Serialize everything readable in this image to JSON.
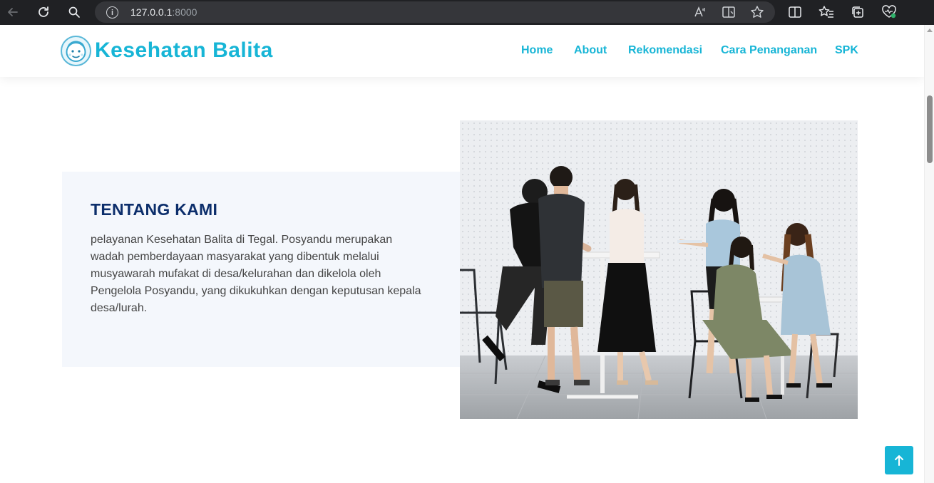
{
  "browser": {
    "url_host": "127.0.0.1",
    "url_port": ":8000",
    "info_glyph": "i",
    "icons": [
      "back-icon",
      "reload-icon",
      "search-icon",
      "info-icon",
      "read-aloud-icon",
      "immersive-reader-icon",
      "favorite-star-icon",
      "split-screen-icon",
      "favorites-icon",
      "collections-icon",
      "browser-essentials-icon"
    ]
  },
  "header": {
    "brand": "Kesehatan Balita",
    "nav": [
      {
        "label": "Home"
      },
      {
        "label": "About"
      },
      {
        "label": "Rekomendasi"
      },
      {
        "label": "Cara Penanganan"
      },
      {
        "label": "SPK"
      }
    ]
  },
  "about": {
    "title": "TENTANG KAMI",
    "body": "pelayanan Kesehatan Balita di Tegal. Posyandu merupakan wadah pemberdayaan masyarakat yang dibentuk melalui musyawarah mufakat di desa/kelurahan dan dikelola oleh Pengelola Posyandu, yang dikukuhkan dengan keputusan kepala desa/lurah."
  },
  "colors": {
    "accent": "#17b5d6",
    "title_navy": "#0c2e6b",
    "section_bg": "#f4f7fc",
    "body_text": "#444444"
  }
}
